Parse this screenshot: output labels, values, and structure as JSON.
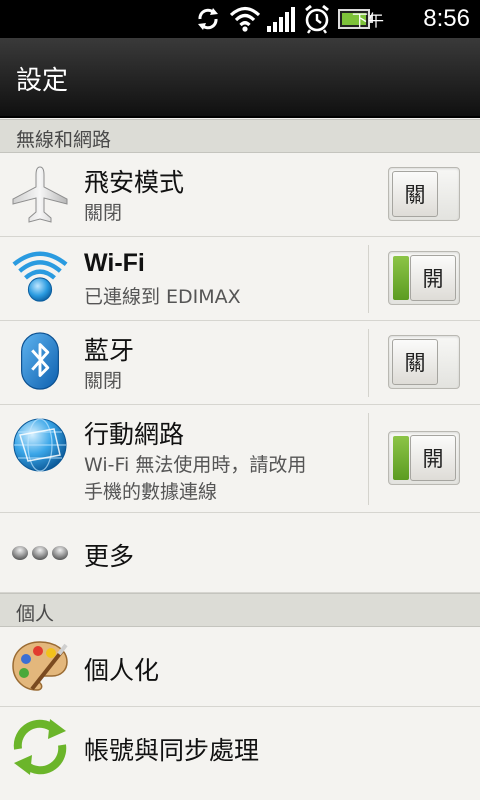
{
  "status_bar": {
    "ampm": "下午",
    "time": "8:56",
    "icons": [
      "sync-icon",
      "wifi-icon",
      "signal-icon",
      "alarm-icon",
      "battery-icon"
    ],
    "battery_color": "#7dc23a"
  },
  "header": {
    "title": "設定"
  },
  "sections": {
    "wireless": "無線和網路",
    "personal": "個人"
  },
  "rows": {
    "airplane": {
      "title": "飛安模式",
      "subtitle": "關閉",
      "toggle": "關",
      "on": false
    },
    "wifi": {
      "title": "Wi-Fi",
      "subtitle": "已連線到 EDIMAX",
      "toggle": "開",
      "on": true
    },
    "bluetooth": {
      "title": "藍牙",
      "subtitle": "關閉",
      "toggle": "關",
      "on": false
    },
    "mobile": {
      "title": "行動網路",
      "subtitle_line1": "Wi-Fi 無法使用時，請改用",
      "subtitle_line2": "手機的數據連線",
      "toggle": "開",
      "on": true
    },
    "more": {
      "title": "更多"
    },
    "personalize": {
      "title": "個人化"
    },
    "sync": {
      "title": "帳號與同步處理"
    }
  },
  "colors": {
    "toggle_on": "#6aab2a",
    "accent_blue": "#1f8ed8"
  }
}
